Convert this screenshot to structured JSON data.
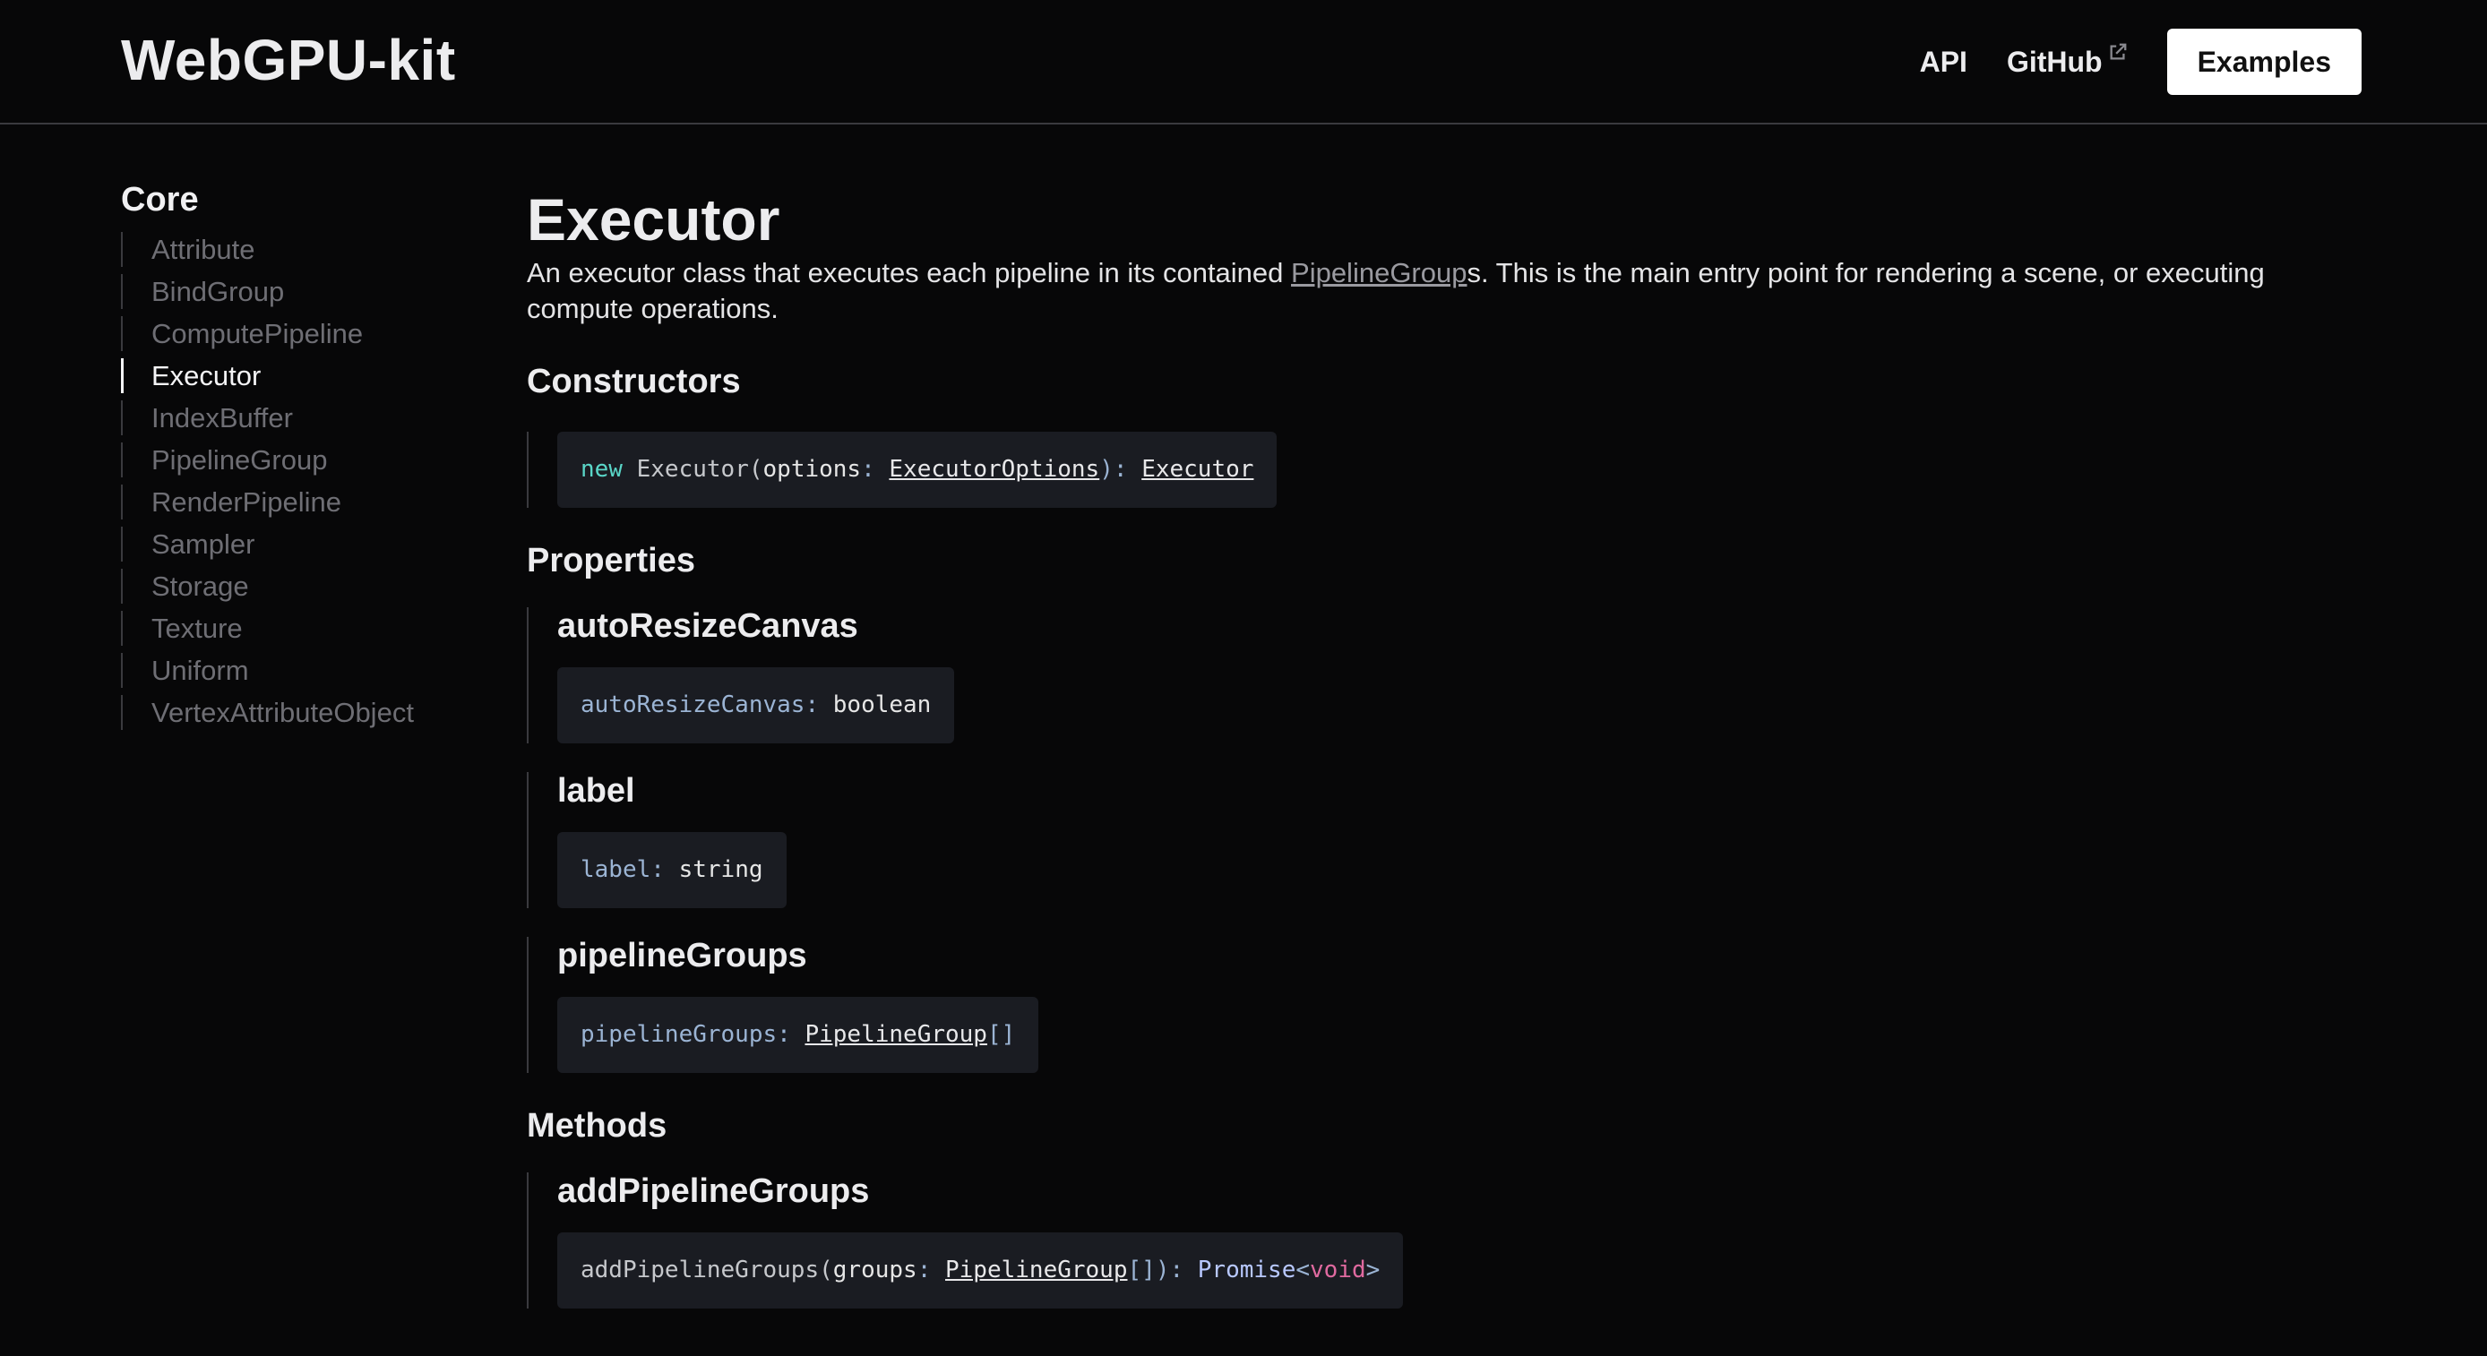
{
  "header": {
    "logo": "WebGPU-kit",
    "nav": {
      "api": "API",
      "github": "GitHub",
      "examples": "Examples"
    }
  },
  "sidebar": {
    "heading": "Core",
    "items": [
      {
        "label": "Attribute",
        "active": false
      },
      {
        "label": "BindGroup",
        "active": false
      },
      {
        "label": "ComputePipeline",
        "active": false
      },
      {
        "label": "Executor",
        "active": true
      },
      {
        "label": "IndexBuffer",
        "active": false
      },
      {
        "label": "PipelineGroup",
        "active": false
      },
      {
        "label": "RenderPipeline",
        "active": false
      },
      {
        "label": "Sampler",
        "active": false
      },
      {
        "label": "Storage",
        "active": false
      },
      {
        "label": "Texture",
        "active": false
      },
      {
        "label": "Uniform",
        "active": false
      },
      {
        "label": "VertexAttributeObject",
        "active": false
      }
    ]
  },
  "main": {
    "title": "Executor",
    "description": {
      "before": "An executor class that executes each pipeline in its contained ",
      "link": "PipelineGroup",
      "after": "s. This is the main entry point for rendering a scene, or executing compute operations."
    },
    "constructors_heading": "Constructors",
    "constructor": {
      "kw": "new",
      "name": " Executor",
      "open": "(",
      "param": "options",
      "colon": ": ",
      "param_type": "ExecutorOptions",
      "close": "): ",
      "return_type": "Executor"
    },
    "properties_heading": "Properties",
    "properties": [
      {
        "name": "autoResizeCanvas",
        "sig_name": "autoResizeCanvas",
        "sig_colon": ": ",
        "sig_type": "boolean"
      },
      {
        "name": "label",
        "sig_name": "label",
        "sig_colon": ": ",
        "sig_type": "string"
      },
      {
        "name": "pipelineGroups",
        "sig_name": "pipelineGroups",
        "sig_colon": ": ",
        "sig_type": "PipelineGroup",
        "sig_suffix": "[]"
      }
    ],
    "methods_heading": "Methods",
    "methods": [
      {
        "name": "addPipelineGroups",
        "sig_name": "addPipelineGroups",
        "open": "(",
        "param": "groups",
        "colon": ": ",
        "param_type": "PipelineGroup",
        "suffix": "[]",
        "close": "): ",
        "ret": "Promise",
        "lt": "<",
        "ret_inner": "void",
        "gt": ">"
      }
    ]
  },
  "colors": {
    "background": "#070708",
    "code_bg": "#1a1c22",
    "keyword": "#5ad6c8",
    "void": "#e06aa0"
  }
}
